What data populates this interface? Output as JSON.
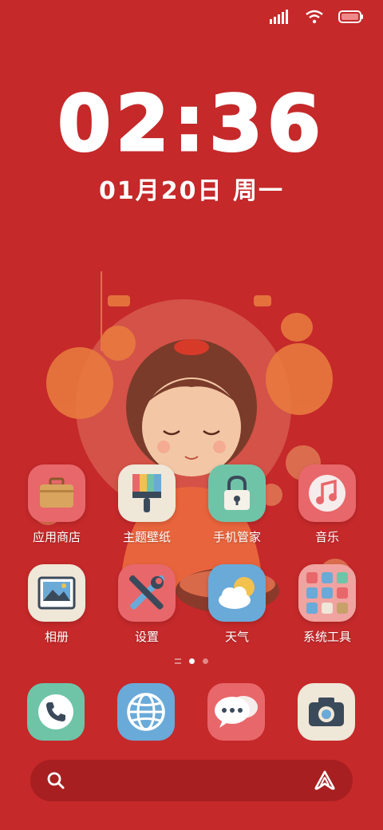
{
  "clock": {
    "time": "02:36",
    "date": "01月20日 周一"
  },
  "apps": [
    {
      "label": "应用商店",
      "icon": "briefcase-icon",
      "color": "#e8676a"
    },
    {
      "label": "主题壁纸",
      "icon": "paintbrush-icon",
      "color": "#efe7d8"
    },
    {
      "label": "手机管家",
      "icon": "lock-icon",
      "color": "#6fc4a8"
    },
    {
      "label": "音乐",
      "icon": "music-note-icon",
      "color": "#e8676a"
    },
    {
      "label": "相册",
      "icon": "gallery-icon",
      "color": "#efe7d8"
    },
    {
      "label": "设置",
      "icon": "tools-icon",
      "color": "#e8676a"
    },
    {
      "label": "天气",
      "icon": "weather-icon",
      "color": "#6aaad8"
    },
    {
      "label": "系统工具",
      "icon": "folder-icon",
      "color": "#f0a3a0"
    }
  ],
  "dock": [
    {
      "name": "phone",
      "icon": "phone-icon",
      "color": "#6fc4a8"
    },
    {
      "name": "browser",
      "icon": "globe-icon",
      "color": "#6aaad8"
    },
    {
      "name": "messages",
      "icon": "chat-icon",
      "color": "#e8676a"
    },
    {
      "name": "camera",
      "icon": "camera-icon",
      "color": "#efe7d8"
    }
  ],
  "colors": {
    "background": "#c5292a",
    "search_bar": "#a81f21"
  }
}
